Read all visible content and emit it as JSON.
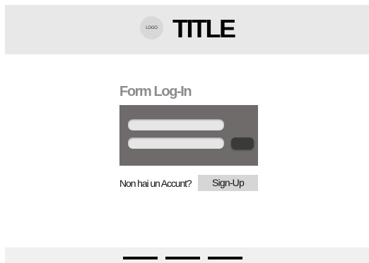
{
  "header": {
    "logo_text": "LOGO",
    "title": "TITLE"
  },
  "login_form": {
    "heading": "Form Log-In",
    "username": {
      "value": "",
      "placeholder": ""
    },
    "password": {
      "value": "",
      "placeholder": ""
    }
  },
  "signup_prompt": {
    "text": "Non hai un Accunt?",
    "button_label": "Sign-Up"
  },
  "footer": {
    "links": [
      "",
      "",
      ""
    ]
  },
  "colors": {
    "header_bg": "#e8e8e8",
    "form_panel_bg": "#6e6b6a",
    "heading_text": "#8c8c8c",
    "signup_bg": "#d6d6d6",
    "footer_bg": "#f0f0f0"
  }
}
